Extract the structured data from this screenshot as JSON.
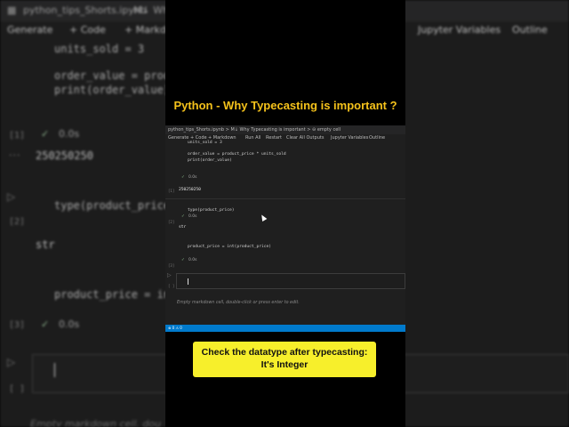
{
  "video_title": "Python - Why Typecasting is important ?",
  "callout": {
    "line1": "Check the datatype after typecasting:",
    "line2": "It's Integer"
  },
  "editor": {
    "tab_file": "python_tips_Shorts.ipynb",
    "breadcrumb": "python_tips_Shorts.ipynb > M↓ Why Typecasting is important > ⊖ empty cell",
    "toolbar": {
      "generate": "Generate",
      "code": "+ Code",
      "markdown": "+ Markdown",
      "run_all": "Run All",
      "restart": "Restart",
      "clear_outputs": "Clear All Outputs",
      "jupyter_variables": "Jupyter Variables",
      "outline": "Outline"
    },
    "cells": [
      {
        "gutter": "",
        "code": "units_sold = 3\n\norder_value = product_price * units_sold\nprint(order_value)",
        "time": "0.0s",
        "gutter_exec": "[1]",
        "output": "250250250"
      },
      {
        "gutter": "[2]",
        "code": "type(product_price)",
        "time": "0.0s",
        "output": "str"
      },
      {
        "gutter": "",
        "code": "product_price = int(product_price)",
        "time": "0.0s",
        "gutter_exec": "[3]"
      },
      {
        "gutter": "[ ]",
        "code": ""
      }
    ],
    "empty_markdown": "Empty markdown cell, double-click or press enter to edit.",
    "status": "⊗ 0 ⚠ 0"
  },
  "background": {
    "tab_file": "python_tips_Shorts.ipynb",
    "tab_rest": "M↓ Wh",
    "toolbar_generate": "Generate",
    "toolbar_code": "+ Code",
    "toolbar_markdown": "+ Markdow",
    "toolbar_variables": "Jupyter Variables",
    "toolbar_outline": "Outline",
    "code1a": "units_sold = 3",
    "code1b": "order_value = produc",
    "code1c": "print(order_value)",
    "exec1": "[1]",
    "time1": "0.0s",
    "out1": "250250250",
    "code2": "type(product_price)",
    "exec2": "[2]",
    "out2": "str",
    "code3": "product_price = int(",
    "exec3": "[3]",
    "time3": "0.0s",
    "exec4": "[ ]",
    "empty": "Empty markdown cell, dou"
  }
}
